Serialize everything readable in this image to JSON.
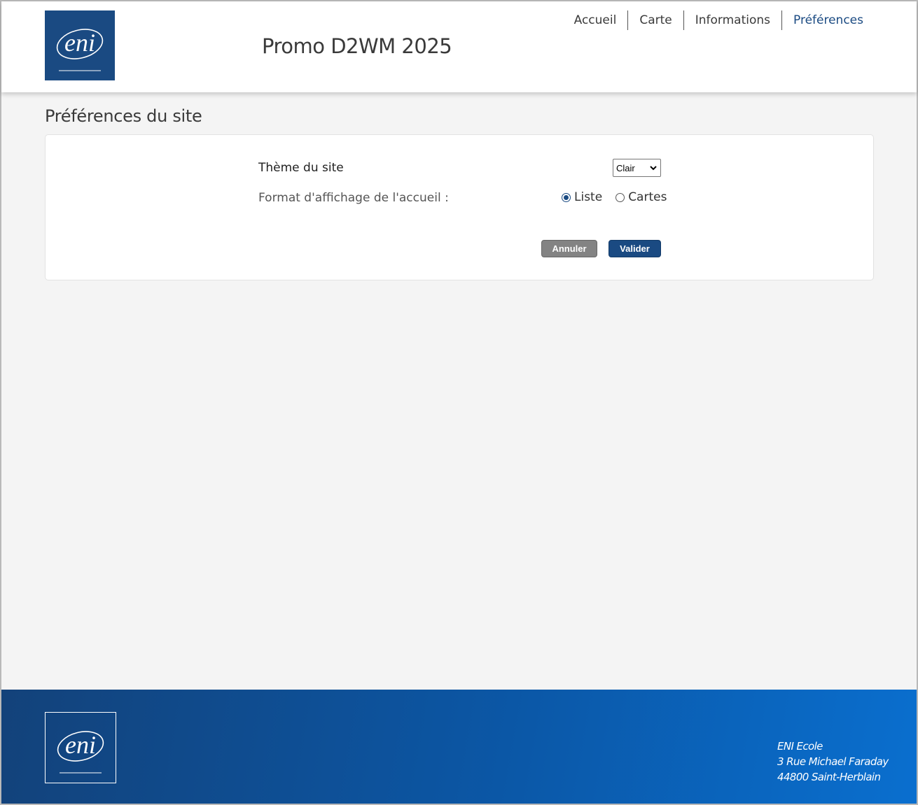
{
  "header": {
    "logo_text": "eni",
    "site_title": "Promo D2WM 2025",
    "nav": [
      {
        "label": "Accueil",
        "active": false
      },
      {
        "label": "Carte",
        "active": false
      },
      {
        "label": "Informations",
        "active": false
      },
      {
        "label": "Préférences",
        "active": true
      }
    ]
  },
  "main": {
    "page_title": "Préférences du site",
    "theme_label": "Thème du site",
    "theme_select": {
      "selected": "Clair"
    },
    "format_label": "Format d'affichage de l'accueil :",
    "format_options": [
      {
        "label": "Liste",
        "checked": true
      },
      {
        "label": "Cartes",
        "checked": false
      }
    ],
    "cancel_label": "Annuler",
    "submit_label": "Valider"
  },
  "footer": {
    "logo_text": "eni",
    "address_lines": [
      "ENI Ecole",
      "3 Rue Michael Faraday",
      "44800 Saint-Herblain"
    ]
  },
  "colors": {
    "brand": "#1a4a82",
    "page_bg": "#f4f4f4",
    "footer_gradient_start": "#13427a",
    "footer_gradient_end": "#0a6fcf",
    "cancel_button": "#838383"
  },
  "icons": {
    "header_logo": "eni-logo",
    "footer_logo": "eni-logo",
    "select_arrow": "chevron-down-icon"
  }
}
